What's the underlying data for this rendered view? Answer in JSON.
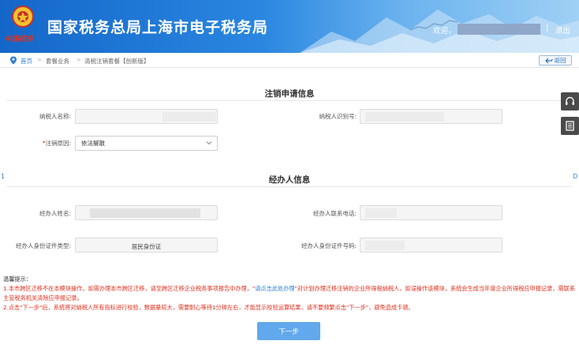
{
  "header": {
    "logo_caption": "中国税务",
    "title": "国家税务总局上海市电子税务局",
    "welcome": "欢迎，",
    "separator": "|",
    "logout": "退出"
  },
  "breadcrumb": {
    "home": "首页",
    "level2": "套餐业务",
    "level3": "清税注销套餐【创新版】",
    "separator": ">",
    "back": "返回"
  },
  "section1": {
    "title": "注销申请信息",
    "taxpayer_name_label": "纳税人名称:",
    "taxpayer_id_label": "纳税人识别号:",
    "reason_required_mark": "*",
    "reason_label": "注销原因:",
    "reason_value": "依法解散"
  },
  "section2": {
    "title": "经办人信息",
    "agent_name_label": "经办人姓名:",
    "agent_phone_label": "经办人联系电话:",
    "id_type_label": "经办人身份证件类型:",
    "id_type_value": "居民身份证",
    "id_number_label": "经办人身份证件号码:"
  },
  "tips": {
    "title": "温馨提示：",
    "line1_a": "1.本市跨区迁移不在本模块操作，如需办理本市跨区迁移，请至跨区迁移企业税务事项报告中办理，\"",
    "line1_link": "请点击此处办理",
    "line1_b": "\"对计划办理迁移注销的企业所得税纳税人，如误操作该模块，系统会生成当年度企业所得税应申报记录，需联系主管税务机关清除应申报记录。",
    "line2": "2.点击\"下一步\"后，系统将对纳税人所有指标进行校验，数据量较大，需要耐心等待1分钟左右，才能显示校验运算结果，请不要频繁点击\"下一步\"，避免造成卡顿。"
  },
  "next_button": "下一步",
  "edge_marks": {
    "left": "1",
    "right": "D"
  },
  "colors": {
    "header_blue": "#1467c9",
    "accent_blue": "#2a7fd4",
    "button_blue": "#62a8ec",
    "warning_red": "#e0301e"
  },
  "icons": [
    "location-pin-icon",
    "back-arrow-icon",
    "chevron-down-icon",
    "headset-icon",
    "manual-book-icon",
    "tax-emblem-icon"
  ]
}
